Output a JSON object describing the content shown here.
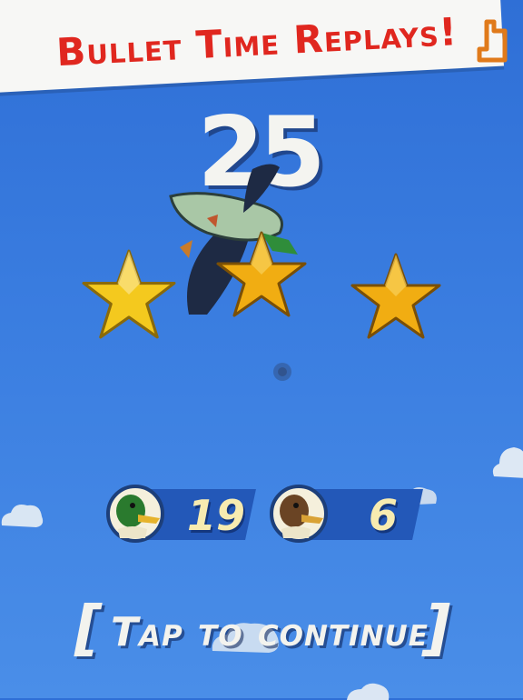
{
  "banner": {
    "title": "Bullet Time Replays!"
  },
  "score": "25",
  "stars": [
    {
      "name": "star-1",
      "filled": true,
      "color": "#f2c21b"
    },
    {
      "name": "star-2",
      "filled": true,
      "color": "#f0ac12"
    },
    {
      "name": "star-3",
      "filled": true,
      "color": "#f0ac12"
    }
  ],
  "tallies": {
    "mallard": {
      "icon": "mallard-duck-icon",
      "count": "19"
    },
    "hen": {
      "icon": "hen-duck-icon",
      "count": "6"
    }
  },
  "continue_prompt": {
    "open_bracket": "[",
    "label": "Tap to continue",
    "close_bracket": "]"
  },
  "colors": {
    "sky": "#3a7de0",
    "banner_text": "#e0271f",
    "star_gold": "#f0ac12",
    "count_text": "#f7ebb0"
  }
}
